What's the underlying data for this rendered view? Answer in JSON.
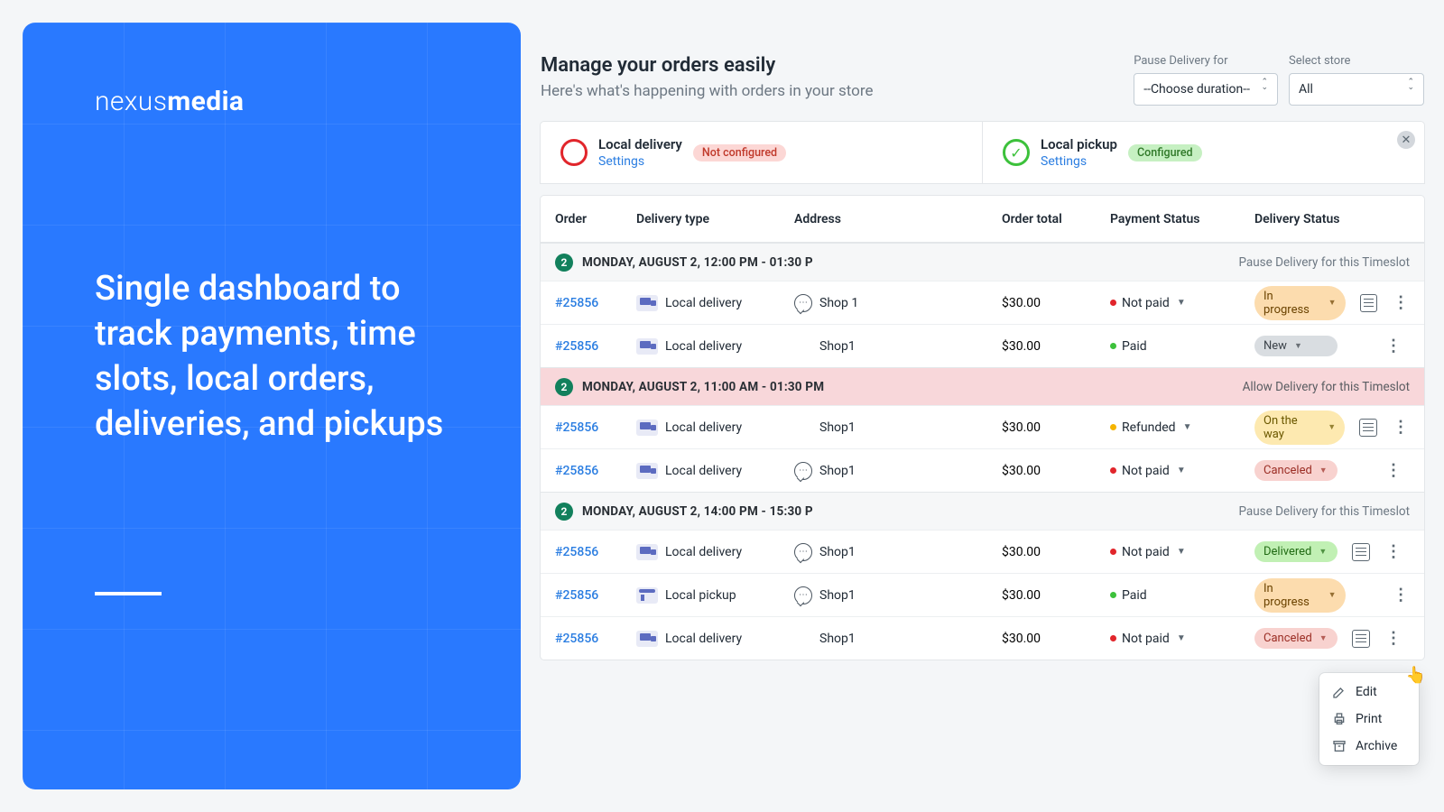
{
  "promo": {
    "brand_light": "nexus",
    "brand_bold": "media",
    "headline": "Single dashboard to track payments, time slots, local orders, deliveries, and pickups"
  },
  "header": {
    "title": "Manage your orders easily",
    "subtitle": "Here's what's happening with orders in your store"
  },
  "filters": {
    "pause_label": "Pause Delivery for",
    "pause_value": "--Choose duration--",
    "store_label": "Select store",
    "store_value": "All"
  },
  "config_cards": {
    "delivery_title": "Local delivery",
    "delivery_badge": "Not configured",
    "pickup_title": "Local pickup",
    "pickup_badge": "Configured",
    "settings_link": "Settings"
  },
  "columns": {
    "order": "Order",
    "delivery_type": "Delivery type",
    "address": "Address",
    "order_total": "Order total",
    "payment_status": "Payment Status",
    "delivery_status": "Delivery Status"
  },
  "groups": [
    {
      "count": "2",
      "label": "MONDAY, AUGUST 2, 12:00 PM - 01:30 P",
      "action": "Pause Delivery for this Timeslot",
      "variant": "normal",
      "rows": [
        {
          "id": "#25856",
          "type": "Local delivery",
          "type_icon": "truck",
          "chat": true,
          "address": "Shop 1",
          "total": "$30.00",
          "pay": "Not paid",
          "pay_dot": "red",
          "pay_caret": true,
          "dstat": "In progress",
          "dstat_class": "progress",
          "note": true
        },
        {
          "id": "#25856",
          "type": "Local delivery",
          "type_icon": "truck",
          "chat": false,
          "address": "Shop1",
          "total": "$30.00",
          "pay": "Paid",
          "pay_dot": "green",
          "pay_caret": false,
          "dstat": "New",
          "dstat_class": "new",
          "note": false
        }
      ]
    },
    {
      "count": "2",
      "label": "MONDAY, AUGUST 2, 11:00 AM - 01:30 PM",
      "action": "Allow Delivery for this Timeslot",
      "variant": "pink",
      "rows": [
        {
          "id": "#25856",
          "type": "Local delivery",
          "type_icon": "truck",
          "chat": false,
          "address": "Shop1",
          "total": "$30.00",
          "pay": "Refunded",
          "pay_dot": "yellow",
          "pay_caret": true,
          "dstat": "On the way",
          "dstat_class": "ontheway",
          "note": true
        },
        {
          "id": "#25856",
          "type": "Local delivery",
          "type_icon": "truck",
          "chat": true,
          "address": "Shop1",
          "total": "$30.00",
          "pay": "Not paid",
          "pay_dot": "red",
          "pay_caret": true,
          "dstat": "Canceled",
          "dstat_class": "canceled",
          "note": false
        }
      ]
    },
    {
      "count": "2",
      "label": "MONDAY, AUGUST 2, 14:00 PM - 15:30 P",
      "action": "Pause Delivery for this Timeslot",
      "variant": "normal",
      "rows": [
        {
          "id": "#25856",
          "type": "Local delivery",
          "type_icon": "truck",
          "chat": true,
          "address": "Shop1",
          "total": "$30.00",
          "pay": "Not paid",
          "pay_dot": "red",
          "pay_caret": true,
          "dstat": "Delivered",
          "dstat_class": "delivered",
          "note": true
        },
        {
          "id": "#25856",
          "type": "Local pickup",
          "type_icon": "shop",
          "chat": true,
          "address": "Shop1",
          "total": "$30.00",
          "pay": "Paid",
          "pay_dot": "green",
          "pay_caret": false,
          "dstat": "In progress",
          "dstat_class": "progress",
          "note": false
        },
        {
          "id": "#25856",
          "type": "Local delivery",
          "type_icon": "truck",
          "chat": false,
          "address": "Shop1",
          "total": "$30.00",
          "pay": "Not paid",
          "pay_dot": "red",
          "pay_caret": true,
          "dstat": "Canceled",
          "dstat_class": "canceled",
          "note": true
        }
      ]
    }
  ],
  "menu": {
    "edit": "Edit",
    "print": "Print",
    "archive": "Archive"
  }
}
